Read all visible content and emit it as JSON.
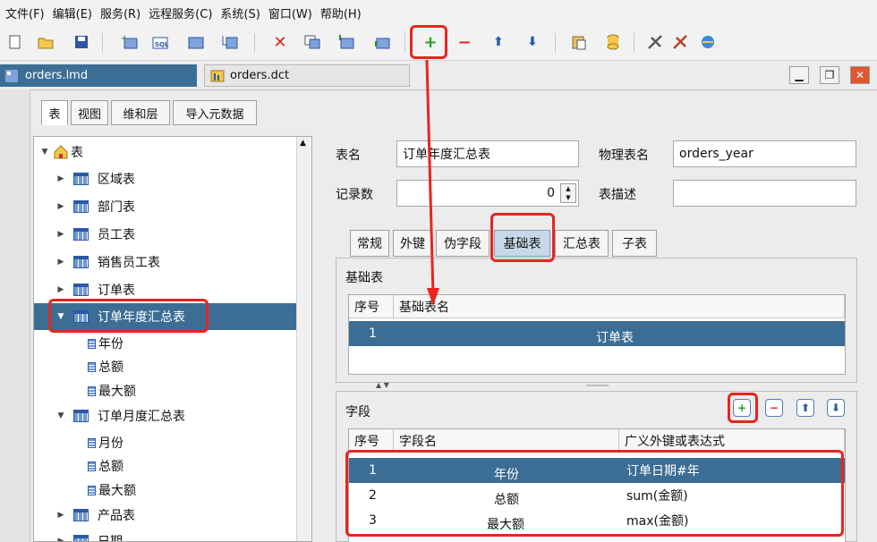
{
  "menu": [
    "文件(F)",
    "编辑(E)",
    "服务(R)",
    "远程服务(C)",
    "系统(S)",
    "窗口(W)",
    "帮助(H)"
  ],
  "doc_tabs": {
    "active": "orders.lmd",
    "inactive": "orders.dct"
  },
  "left_tabs": [
    "表",
    "视图",
    "维和层",
    "导入元数据"
  ],
  "tree": {
    "root": "表",
    "items": [
      {
        "label": "区域表"
      },
      {
        "label": "部门表"
      },
      {
        "label": "员工表"
      },
      {
        "label": "销售员工表"
      },
      {
        "label": "订单表"
      },
      {
        "label": "订单年度汇总表"
      },
      {
        "label": "年份"
      },
      {
        "label": "总额"
      },
      {
        "label": "最大额"
      },
      {
        "label": "订单月度汇总表"
      },
      {
        "label": "月份"
      },
      {
        "label": "总额"
      },
      {
        "label": "最大额"
      },
      {
        "label": "产品表"
      },
      {
        "label": "日期"
      }
    ]
  },
  "form": {
    "table_name_label": "表名",
    "table_name_value": "订单年度汇总表",
    "physical_name_label": "物理表名",
    "physical_name_value": "orders_year",
    "record_count_label": "记录数",
    "record_count_value": "0",
    "description_label": "表描述",
    "description_value": ""
  },
  "sub_tabs": [
    "常规",
    "外键",
    "伪字段",
    "基础表",
    "汇总表",
    "子表"
  ],
  "base_table": {
    "title": "基础表",
    "headers": [
      "序号",
      "基础表名"
    ],
    "rows": [
      {
        "no": "1",
        "name": "订单表"
      }
    ]
  },
  "fields": {
    "title": "字段",
    "headers": [
      "序号",
      "字段名",
      "广义外键或表达式"
    ],
    "rows": [
      {
        "no": "1",
        "name": "年份",
        "expr": "订单日期#年"
      },
      {
        "no": "2",
        "name": "总额",
        "expr": "sum(金额)"
      },
      {
        "no": "3",
        "name": "最大额",
        "expr": "max(金额)"
      }
    ]
  },
  "colors": {
    "selection": "#3c6e95",
    "highlight": "#e8251e"
  }
}
